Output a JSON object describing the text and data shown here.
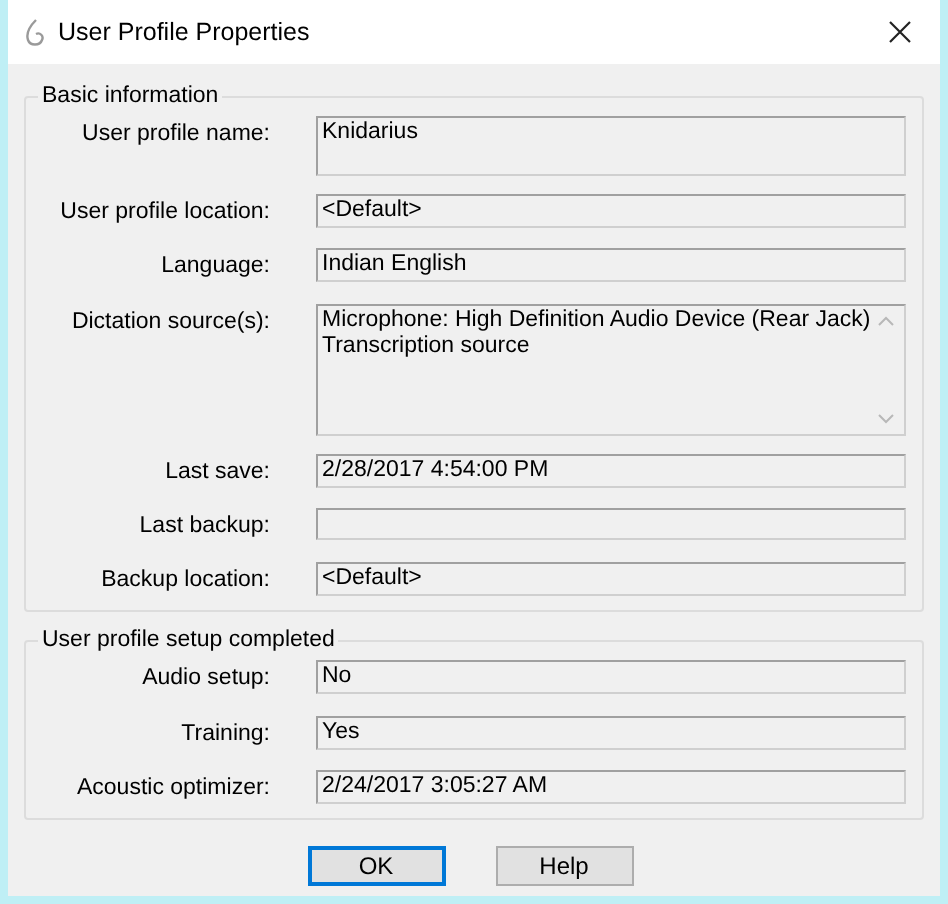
{
  "window": {
    "title": "User Profile Properties"
  },
  "groups": [
    {
      "title": "Basic information",
      "fields": [
        {
          "label": "User profile name:",
          "kind": "tall",
          "lines": [
            "Knidarius"
          ]
        },
        {
          "label": "User profile location:",
          "kind": "single",
          "lines": [
            "<Default>"
          ]
        },
        {
          "label": "Language:",
          "kind": "single",
          "lines": [
            "Indian English"
          ]
        },
        {
          "label": "Dictation source(s):",
          "kind": "list",
          "lines": [
            "Microphone: High Definition Audio Device (Rear Jack)",
            "Transcription source"
          ]
        },
        {
          "label": "Last save:",
          "kind": "single",
          "lines": [
            "2/28/2017 4:54:00 PM"
          ]
        },
        {
          "label": "Last backup:",
          "kind": "single"
        },
        {
          "label": "Backup location:",
          "kind": "single",
          "lines": [
            "<Default>"
          ]
        }
      ]
    },
    {
      "title": "User profile setup completed",
      "fields": [
        {
          "label": "Audio setup:",
          "kind": "single",
          "lines": [
            "No"
          ]
        },
        {
          "label": "Training:",
          "kind": "single",
          "lines": [
            "Yes"
          ]
        },
        {
          "label": "Acoustic optimizer:",
          "kind": "single",
          "lines": [
            "2/24/2017 3:05:27 AM"
          ]
        }
      ]
    }
  ],
  "buttons": [
    {
      "label": "OK",
      "default": true
    },
    {
      "label": "Help",
      "default": false
    }
  ]
}
